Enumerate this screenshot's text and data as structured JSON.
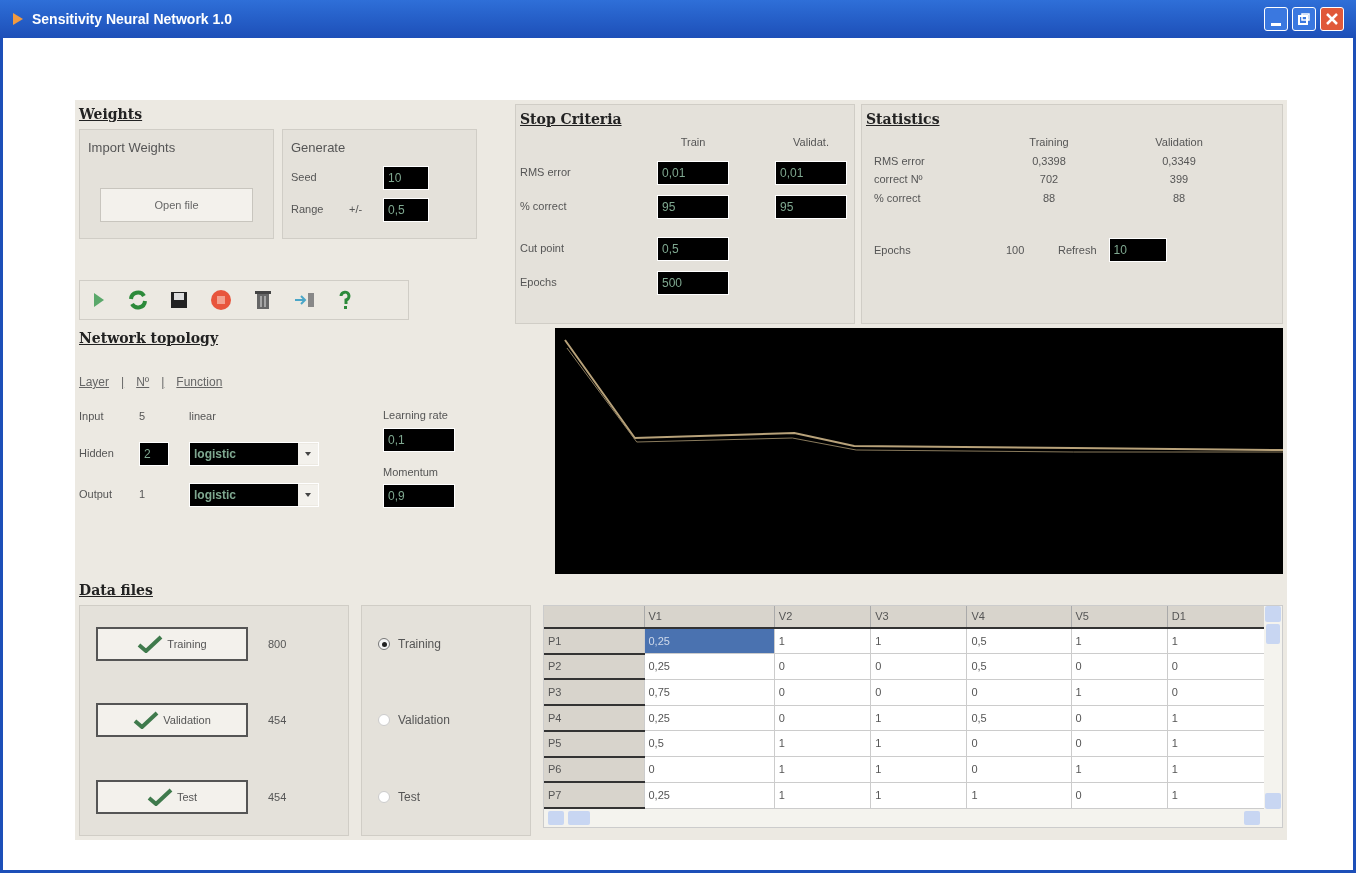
{
  "window": {
    "title": "Sensitivity Neural Network 1.0"
  },
  "weights": {
    "title": "Weights",
    "import": {
      "title": "Import Weights",
      "button": "Open file"
    },
    "generate": {
      "title": "Generate",
      "seed_label": "Seed",
      "seed": "10",
      "range_label": "Range",
      "range_sign": "+/-",
      "range": "0,5"
    }
  },
  "toolbar": [
    {
      "kind": "play"
    },
    {
      "kind": "refresh"
    },
    {
      "kind": "save"
    },
    {
      "kind": "stop"
    },
    {
      "kind": "delete"
    },
    {
      "kind": "import"
    },
    {
      "kind": "help"
    }
  ],
  "stop_criteria": {
    "title": "Stop Criteria",
    "col_train": "Train",
    "col_valid": "Validat.",
    "rows": [
      {
        "label": "RMS error",
        "train": "0,01",
        "valid": "0,01"
      },
      {
        "label": "% correct",
        "train": "95",
        "valid": "95"
      }
    ],
    "cut_label": "Cut point",
    "cut": "0,5",
    "epochs_label": "Epochs",
    "epochs": "500"
  },
  "statistics": {
    "title": "Statistics",
    "col_train": "Training",
    "col_valid": "Validation",
    "rows": [
      {
        "label": "RMS error",
        "train": "0,3398",
        "valid": "0,3349"
      },
      {
        "label": "correct Nº",
        "train": "702",
        "valid": "399"
      },
      {
        "label": "% correct",
        "train": "88",
        "valid": "88"
      }
    ],
    "epochs_label": "Epochs",
    "epochs": "100",
    "refresh_label": "Refresh",
    "refresh": "10"
  },
  "topology": {
    "title": "Network topology",
    "header": [
      "Layer",
      "|",
      "Nº",
      "|",
      "Function"
    ],
    "layers": [
      {
        "kind": "fixed",
        "label": "Input",
        "count": "5",
        "function": "linear"
      },
      {
        "kind": "editable",
        "label": "Hidden",
        "count": "2",
        "function": "logistic"
      },
      {
        "kind": "fixed",
        "label": "Output",
        "count": "1",
        "function": "logistic"
      }
    ],
    "learning_rate_label": "Learning rate",
    "learning_rate": "0,1",
    "momentum_label": "Momentum",
    "momentum": "0,9"
  },
  "data_files": {
    "title": "Data files",
    "files": [
      {
        "label": "Training",
        "count": "800"
      },
      {
        "label": "Validation",
        "count": "454"
      },
      {
        "label": "Test",
        "count": "454"
      }
    ],
    "views": [
      {
        "label": "Training",
        "selected": true
      },
      {
        "label": "Validation",
        "selected": false
      },
      {
        "label": "Test",
        "selected": false
      }
    ],
    "table": {
      "columns": [
        "V1",
        "V2",
        "V3",
        "V4",
        "V5",
        "D1"
      ],
      "rows": [
        {
          "name": "P1",
          "cells": [
            "0,25",
            "1",
            "1",
            "0,5",
            "1",
            "1"
          ]
        },
        {
          "name": "P2",
          "cells": [
            "0,25",
            "0",
            "0",
            "0,5",
            "0",
            "0"
          ]
        },
        {
          "name": "P3",
          "cells": [
            "0,75",
            "0",
            "0",
            "0",
            "1",
            "0"
          ]
        },
        {
          "name": "P4",
          "cells": [
            "0,25",
            "0",
            "1",
            "0,5",
            "0",
            "1"
          ]
        },
        {
          "name": "P5",
          "cells": [
            "0,5",
            "1",
            "1",
            "0",
            "0",
            "1"
          ]
        },
        {
          "name": "P6",
          "cells": [
            "0",
            "1",
            "1",
            "0",
            "1",
            "1"
          ]
        },
        {
          "name": "P7",
          "cells": [
            "0,25",
            "1",
            "1",
            "1",
            "0",
            "1"
          ]
        }
      ]
    }
  }
}
